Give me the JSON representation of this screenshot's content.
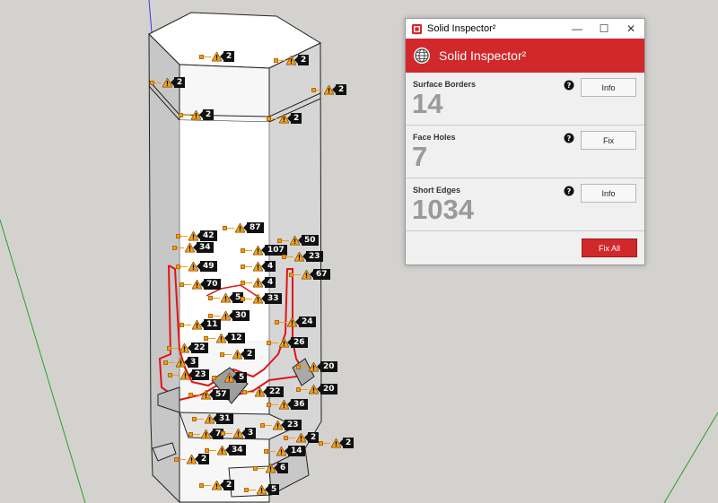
{
  "window": {
    "title": "Solid Inspector²",
    "controls": {
      "minimize": "—",
      "maximize": "☐",
      "close": "✕"
    }
  },
  "banner": {
    "title": "Solid Inspector²"
  },
  "issues": [
    {
      "label": "Surface Borders",
      "count": "14",
      "button": "Info"
    },
    {
      "label": "Face Holes",
      "count": "7",
      "button": "Fix"
    },
    {
      "label": "Short Edges",
      "count": "1034",
      "button": "Info"
    }
  ],
  "fix_all_label": "Fix All",
  "markers": [
    "2",
    "2",
    "2",
    "2",
    "2",
    "2",
    "87",
    "42",
    "50",
    "34",
    "107",
    "23",
    "49",
    "4",
    "67",
    "70",
    "4",
    "5",
    "33",
    "30",
    "11",
    "24",
    "12",
    "26",
    "22",
    "2",
    "3",
    "20",
    "23",
    "5",
    "20",
    "57",
    "22",
    "36",
    "31",
    "23",
    "7",
    "3",
    "2",
    "2",
    "34",
    "14",
    "2",
    "6",
    "2",
    "5"
  ],
  "colors": {
    "accent": "#d1282b",
    "warning": "#f29a1d"
  }
}
